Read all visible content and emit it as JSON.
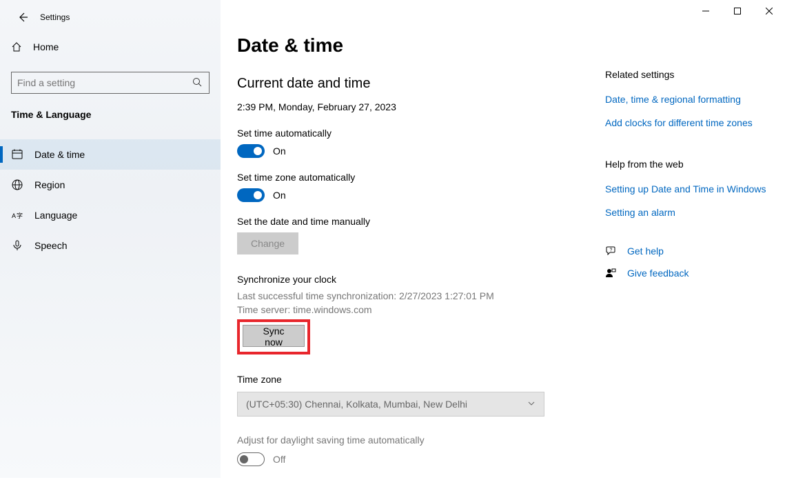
{
  "window": {
    "title": "Settings"
  },
  "sidebar": {
    "home": "Home",
    "searchPlaceholder": "Find a setting",
    "category": "Time & Language",
    "items": [
      {
        "label": "Date & time",
        "selected": true
      },
      {
        "label": "Region",
        "selected": false
      },
      {
        "label": "Language",
        "selected": false
      },
      {
        "label": "Speech",
        "selected": false
      }
    ]
  },
  "main": {
    "title": "Date & time",
    "currentHeading": "Current date and time",
    "currentValue": "2:39 PM, Monday, February 27, 2023",
    "setTimeAuto": {
      "label": "Set time automatically",
      "state": "On",
      "on": true
    },
    "setZoneAuto": {
      "label": "Set time zone automatically",
      "state": "On",
      "on": true
    },
    "manual": {
      "label": "Set the date and time manually",
      "button": "Change"
    },
    "sync": {
      "heading": "Synchronize your clock",
      "lastSync": "Last successful time synchronization: 2/27/2023 1:27:01 PM",
      "server": "Time server: time.windows.com",
      "button": "Sync now"
    },
    "timezone": {
      "heading": "Time zone",
      "value": "(UTC+05:30) Chennai, Kolkata, Mumbai, New Delhi"
    },
    "dst": {
      "label": "Adjust for daylight saving time automatically",
      "state": "Off",
      "on": false
    }
  },
  "right": {
    "relatedHeading": "Related settings",
    "links": [
      "Date, time & regional formatting",
      "Add clocks for different time zones"
    ],
    "helpHeading": "Help from the web",
    "helpLinks": [
      "Setting up Date and Time in Windows",
      "Setting an alarm"
    ],
    "getHelp": "Get help",
    "feedback": "Give feedback"
  }
}
